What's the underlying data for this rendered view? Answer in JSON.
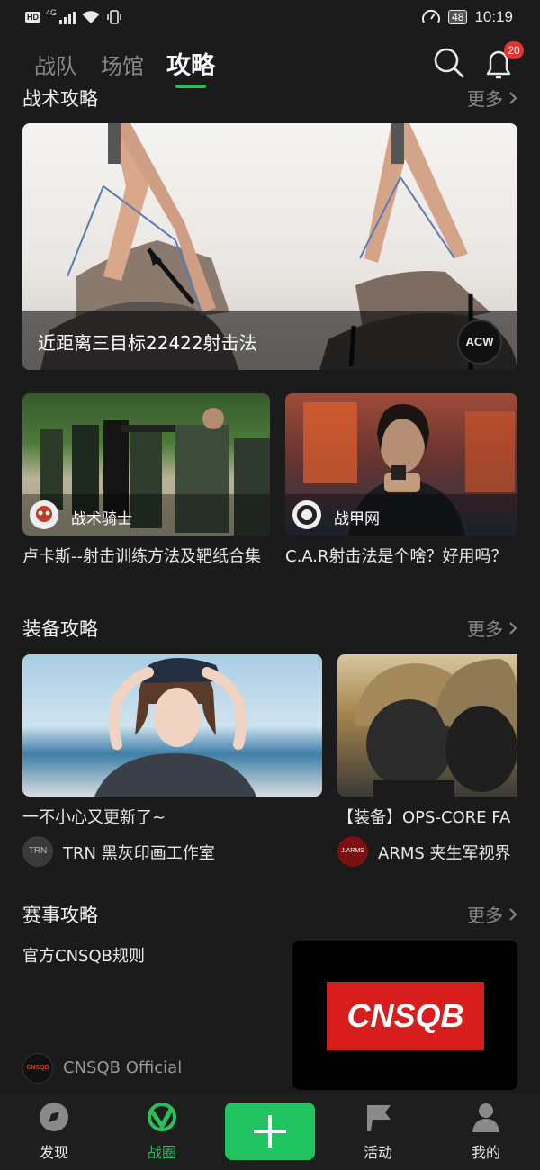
{
  "status_bar": {
    "hd": "HD",
    "network": "4G",
    "battery": "48",
    "time": "10:19"
  },
  "top_tabs": [
    "战队",
    "场馆",
    "攻略"
  ],
  "notification_count": "20",
  "accent_color": "#2bbf5c",
  "sections": {
    "tactics": {
      "title": "战术攻略",
      "more": "更多",
      "featured": {
        "title": "近距离三目标22422射击法",
        "badge_text": "ACW"
      },
      "cards": [
        {
          "author": "战术骑士",
          "title": "卢卡斯--射击训练方法及靶纸合集"
        },
        {
          "author": "战甲网",
          "title": "C.A.R射击法是个啥？好用吗？"
        }
      ]
    },
    "equipment": {
      "title": "装备攻略",
      "more": "更多",
      "cards": [
        {
          "title": "一不小心又更新了~",
          "author": "TRN 黑灰印画工作室",
          "avatar": "TRN"
        },
        {
          "title": "【装备】OPS-CORE FA",
          "author": "ARMS 夹生军视界",
          "avatar": "J.ARMS"
        }
      ]
    },
    "competition": {
      "title": "赛事攻略",
      "more": "更多",
      "item": {
        "title": "官方CNSQB规则",
        "author": "CNSQB Official",
        "logo_text": "CNSQB",
        "avatar": "CNSQB"
      }
    }
  },
  "bottom_nav": [
    "发现",
    "战圈",
    "活动",
    "我的"
  ]
}
